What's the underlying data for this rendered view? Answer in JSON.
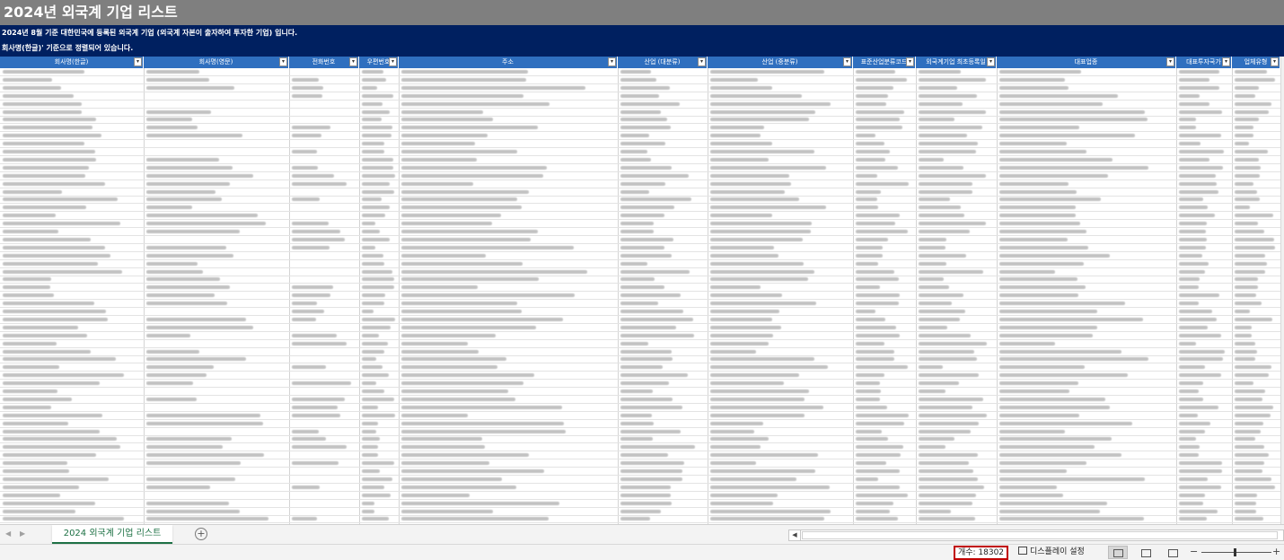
{
  "sheet": {
    "title": "2024년 외국계 기업 리스트",
    "description_line1": "2024년 8월 기준 대한민국에 등록된 외국계 기업 (외국계 자본이 출자하여 투자한 기업) 입니다.",
    "description_line2": "회사명(한글)' 기준으로 정렬되어 있습니다."
  },
  "columns": [
    {
      "label": "회사명(한글)"
    },
    {
      "label": "회사명(영문)"
    },
    {
      "label": "전화번호"
    },
    {
      "label": "우편번호"
    },
    {
      "label": "주소"
    },
    {
      "label": "산업 (대분류)"
    },
    {
      "label": "산업 (중분류)"
    },
    {
      "label": "표준산업분류코드"
    },
    {
      "label": "외국계기업 최초등록일"
    },
    {
      "label": "대표업종"
    },
    {
      "label": "대표투자국가"
    },
    {
      "label": "업체유형"
    }
  ],
  "tabs": {
    "active": "2024 외국계 기업 리스트",
    "prev_icon": "chevron-left-icon",
    "next_icon": "chevron-right-icon",
    "add_icon": "plus-icon"
  },
  "status": {
    "count_label": "개수: 18302",
    "display_settings": "디스플레이 설정",
    "zoom_minus": "−",
    "zoom_plus": "+",
    "views": [
      "normal-view-icon",
      "page-layout-icon",
      "page-break-preview-icon"
    ]
  },
  "colors": {
    "title_bg": "#7f7f7f",
    "desc_bg": "#002060",
    "header_bg": "#2f6fbf",
    "count_border": "#c00000",
    "tab_accent": "#1e7145"
  }
}
